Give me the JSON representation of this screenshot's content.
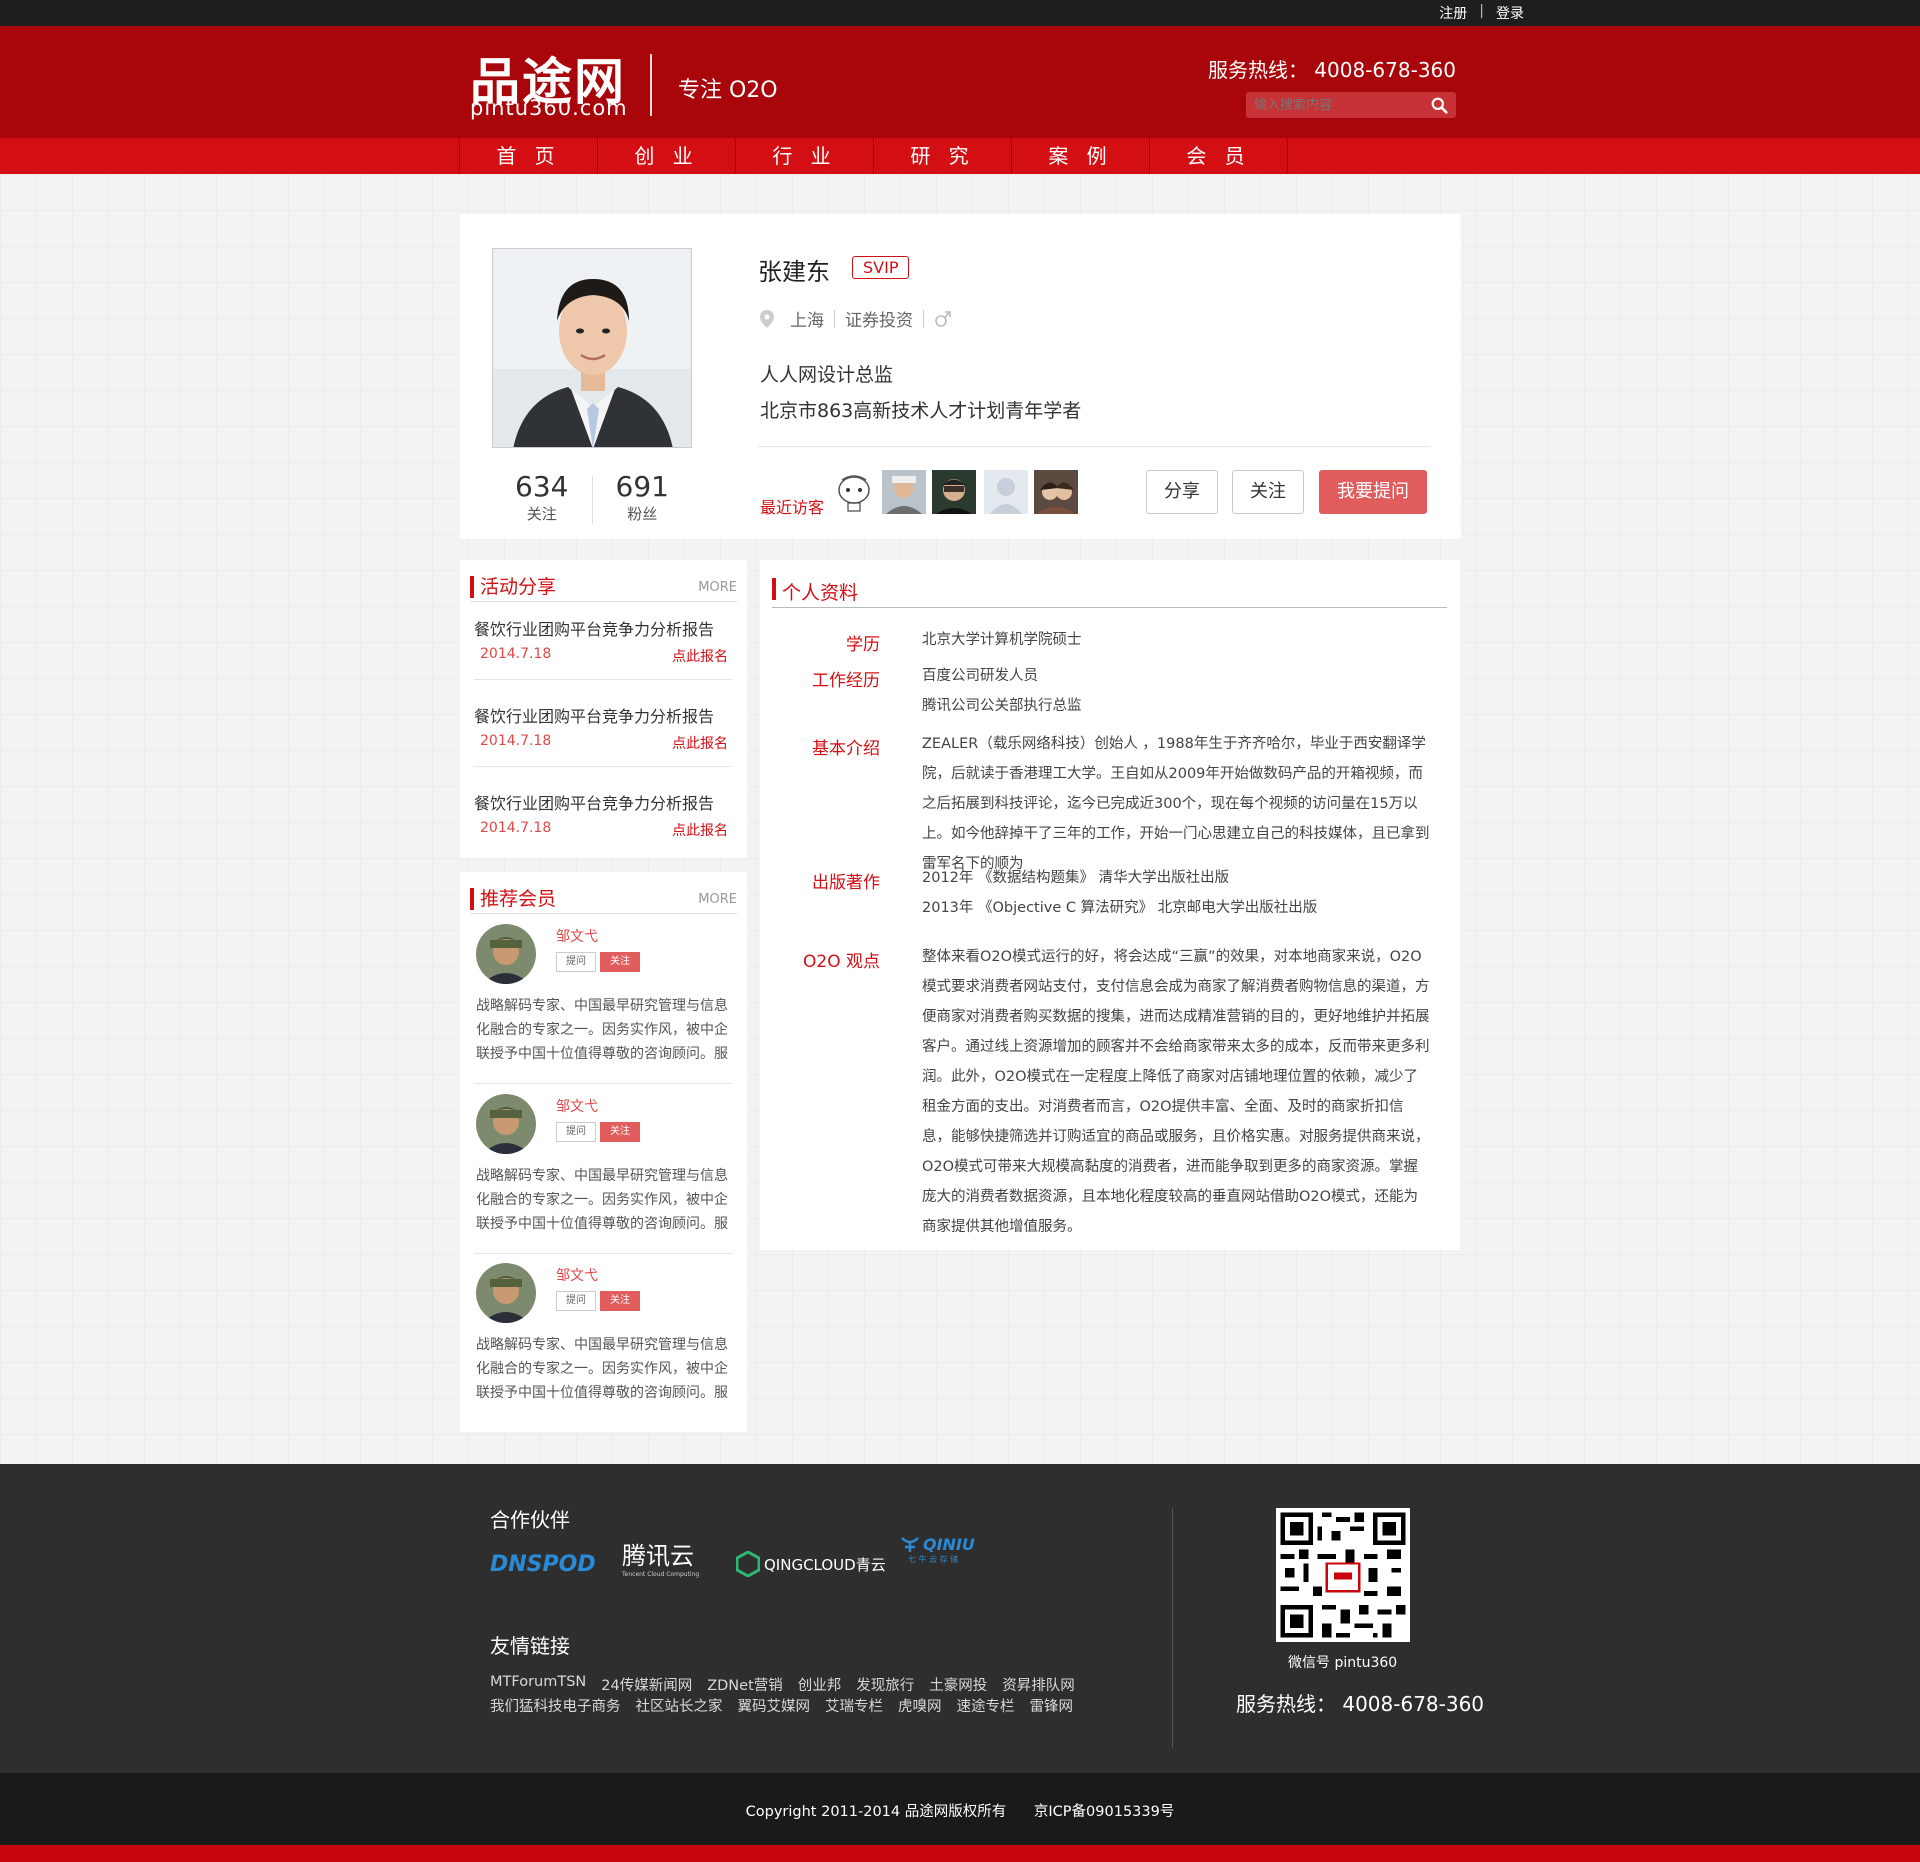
{
  "topbar": {
    "register": "注册",
    "sep": "|",
    "login": "登录"
  },
  "header": {
    "logo_cn": "品途网",
    "logo_en": "pintu360.com",
    "slogan": "专注 O2O",
    "hotline": "服务热线： 4008-678-360",
    "search_placeholder": "输入搜索内容"
  },
  "nav": {
    "items": [
      "首 页",
      "创 业",
      "行 业",
      "研 究",
      "案 例",
      "会 员"
    ],
    "active_index": 5
  },
  "profile": {
    "name": "张建东",
    "badge": "SVIP",
    "city": "上海",
    "industry": "证券投资",
    "gender_icon": "male-symbol",
    "title1": "人人网设计总监",
    "title2": "北京市863高新技术人才计划青年学者",
    "follow_count": "634",
    "follow_label": "关注",
    "fans_count": "691",
    "fans_label": "粉丝",
    "visitors_label": "最近访客",
    "share_btn": "分享",
    "follow_btn": "关注",
    "ask_btn": "我要提问"
  },
  "activities": {
    "title": "活动分享",
    "more": "MORE",
    "items": [
      {
        "title": "餐饮行业团购平台竞争力分析报告",
        "date": "2014.7.18",
        "signup": "点此报名"
      },
      {
        "title": "餐饮行业团购平台竞争力分析报告",
        "date": "2014.7.18",
        "signup": "点此报名"
      },
      {
        "title": "餐饮行业团购平台竞争力分析报告",
        "date": "2014.7.18",
        "signup": "点此报名"
      }
    ]
  },
  "members": {
    "title": "推荐会员",
    "more": "MORE",
    "items": [
      {
        "name": "邹文弋",
        "ask": "提问",
        "follow": "关注",
        "desc": "战略解码专家、中国最早研究管理与信息化融合的专家之一。因务实作风，被中企联授予中国十位值得尊敬的咨询顾问。服"
      },
      {
        "name": "邹文弋",
        "ask": "提问",
        "follow": "关注",
        "desc": "战略解码专家、中国最早研究管理与信息化融合的专家之一。因务实作风，被中企联授予中国十位值得尊敬的咨询顾问。服"
      },
      {
        "name": "邹文弋",
        "ask": "提问",
        "follow": "关注",
        "desc": "战略解码专家、中国最早研究管理与信息化融合的专家之一。因务实作风，被中企联授予中国十位值得尊敬的咨询顾问。服"
      }
    ]
  },
  "info": {
    "title": "个人资料",
    "education_label": "学历",
    "education": "北京大学计算机学院硕士",
    "work_label": "工作经历",
    "work1": "百度公司研发人员",
    "work2": "腾讯公司公关部执行总监",
    "intro_label": "基本介绍",
    "intro": "ZEALER（载乐网络科技）创始人 ，1988年生于齐齐哈尔，毕业于西安翻译学院，后就读于香港理工大学。王自如从2009年开始做数码产品的开箱视频，而之后拓展到科技评论，迄今已完成近300个，现在每个视频的访问量在15万以上。如今他辞掉干了三年的工作，开始一门心思建立自己的科技媒体，且已拿到雷军名下的顺为",
    "pub_label": "出版著作",
    "pub1": "2012年 《数据结构题集》 清华大学出版社出版",
    "pub2": "2013年 《Objective C 算法研究》 北京邮电大学出版社出版",
    "o2o_label": "O2O 观点",
    "o2o": "整体来看O2O模式运行的好，将会达成“三赢”的效果，对本地商家来说，O2O模式要求消费者网站支付，支付信息会成为商家了解消费者购物信息的渠道，方便商家对消费者购买数据的搜集，进而达成精准营销的目的，更好地维护并拓展客户。通过线上资源增加的顾客并不会给商家带来太多的成本，反而带来更多利润。此外，O2O模式在一定程度上降低了商家对店铺地理位置的依赖，减少了租金方面的支出。对消费者而言，O2O提供丰富、全面、及时的商家折扣信息，能够快捷筛选并订购适宜的商品或服务，且价格实惠。对服务提供商来说，O2O模式可带来大规模高黏度的消费者，进而能争取到更多的商家资源。掌握庞大的消费者数据资源，且本地化程度较高的垂直网站借助O2O模式，还能为商家提供其他增值服务。"
  },
  "footer": {
    "partners_title": "合作伙伴",
    "partners": [
      "DNSPOD",
      "腾讯云",
      "Tencent Cloud Computing",
      "QINGCLOUD青云",
      "QINIU",
      "七 牛 云 存 储"
    ],
    "links_title": "友情链接",
    "links_row1": [
      "MTForumTSN",
      "24传媒新闻网",
      "ZDNet营销",
      "创业邦",
      "发现旅行",
      "土豪网投",
      "资昇排队网"
    ],
    "links_row2": [
      "我们猛科技电子商务",
      "社区站长之家",
      "翼码艾媒网",
      "艾瑞专栏",
      "虎嗅网",
      "速途专栏",
      "雷锋网"
    ],
    "wechat": "微信号 pintu360",
    "hotline": "服务热线： 4008-678-360",
    "copyright": "Copyright 2011-2014 品途网版权所有      京ICP备09015339号"
  },
  "colors": {
    "brand_red": "#a8060b",
    "nav_red": "#d40f14",
    "accent": "#e15c5c",
    "footer_bg": "#2e2e2e"
  }
}
